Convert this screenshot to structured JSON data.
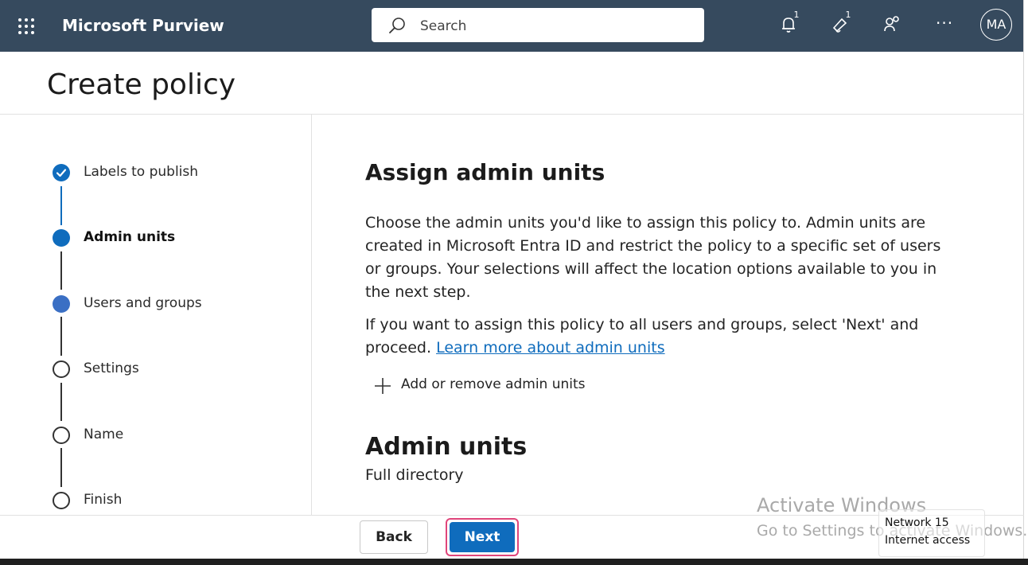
{
  "header": {
    "app_name": "Microsoft Purview",
    "search_placeholder": "Search",
    "notification_badge": "1",
    "announcements_badge": "1",
    "more_label": "···",
    "avatar_initials": "MA"
  },
  "page": {
    "title": "Create policy"
  },
  "steps": [
    {
      "label": "Labels to publish",
      "state": "completed"
    },
    {
      "label": "Admin units",
      "state": "current"
    },
    {
      "label": "Users and groups",
      "state": "upcoming"
    },
    {
      "label": "Settings",
      "state": "not-started"
    },
    {
      "label": "Name",
      "state": "not-started"
    },
    {
      "label": "Finish",
      "state": "not-started"
    }
  ],
  "content": {
    "heading": "Assign admin units",
    "description": "Choose the admin units you'd like to assign this policy to. Admin units are created in Microsoft Entra ID and restrict the policy to a specific set of users or groups. Your selections will affect the location options available to you in the next step.",
    "instruction": "If you want to assign this policy to all users and groups, select 'Next' and proceed.",
    "learn_more_link": "Learn more about admin units",
    "add_remove_label": "Add or remove admin units",
    "admin_units_heading": "Admin units",
    "admin_units_value": "Full directory"
  },
  "footer": {
    "back_label": "Back",
    "next_label": "Next"
  },
  "overlay": {
    "watermark_title": "Activate Windows",
    "watermark_subtitle": "Go to Settings to activate Windows.",
    "network_name": "Network 15",
    "network_status": "Internet access"
  },
  "colors": {
    "topbar": "#364a5e",
    "accent": "#0f6cbd",
    "highlight_border": "#e0457b"
  }
}
